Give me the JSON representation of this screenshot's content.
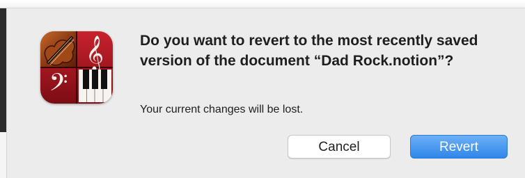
{
  "dialog": {
    "message": "Do you want to revert to the most recently saved version of the document “Dad Rock.notion”?",
    "informative_text": "Your current changes will be lost.",
    "buttons": {
      "cancel_label": "Cancel",
      "revert_label": "Revert"
    },
    "app_icon": "notion-app-icon",
    "colors": {
      "background": "#ececec",
      "default_button": "#3b8ff0",
      "icon_red": "#a11620",
      "icon_wood": "#8a3a14"
    }
  }
}
